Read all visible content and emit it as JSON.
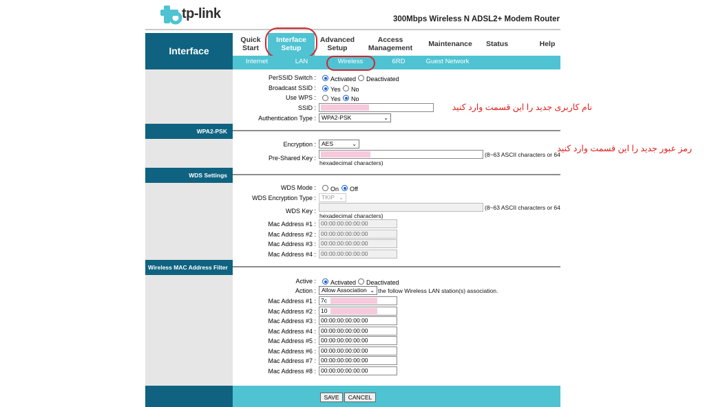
{
  "header": {
    "logo_text": "tp-link",
    "product_title": "300Mbps Wireless N ADSL2+ Modem Router"
  },
  "nav": {
    "section_label": "Interface",
    "items": [
      {
        "label": "Quick\nStart"
      },
      {
        "label": "Interface\nSetup"
      },
      {
        "label": "Advanced\nSetup"
      },
      {
        "label": "Access\nManagement"
      },
      {
        "label": "Maintenance"
      },
      {
        "label": "Status"
      },
      {
        "label": "Help"
      }
    ],
    "subitems": [
      "Internet",
      "LAN",
      "Wireless",
      "6RD",
      "Guest Network"
    ]
  },
  "ssid_section": {
    "perssid_label": "PerSSID Switch :",
    "perssid_on": "Activated",
    "perssid_off": "Deactivated",
    "broadcast_label": "Broadcast SSID :",
    "broadcast_yes": "Yes",
    "broadcast_no": "No",
    "wps_label": "Use WPS :",
    "wps_yes": "Yes",
    "wps_no": "No",
    "ssid_label": "SSID :",
    "auth_label": "Authentication Type :",
    "auth_value": "WPA2-PSK",
    "annotation": "نام کاربری جدید را این قسمت وارد کنید"
  },
  "wpa_section": {
    "title": "WPA2-PSK",
    "encryption_label": "Encryption :",
    "encryption_value": "AES",
    "psk_label": "Pre-Shared Key :",
    "psk_note": "(8~63 ASCII characters or 64",
    "psk_note2": "hexadecimal characters)",
    "annotation": "رمز عبور جدید را این قسمت وارد کنید"
  },
  "wds_section": {
    "title": "WDS Settings",
    "mode_label": "WDS Mode :",
    "mode_on": "On",
    "mode_off": "Off",
    "enc_label": "WDS Encryption Type :",
    "enc_value": "TKIP",
    "key_label": "WDS Key :",
    "key_note": "(8~63 ASCII characters or 64",
    "key_note2": "hexadecimal characters)",
    "macs": [
      {
        "label": "Mac Address #1 :",
        "value": "00:00:00:00:00:00"
      },
      {
        "label": "Mac Address #2 :",
        "value": "00:00:00:00:00:00"
      },
      {
        "label": "Mac Address #3 :",
        "value": "00:00:00:00:00:00"
      },
      {
        "label": "Mac Address #4 :",
        "value": "00:00:00:00:00:00"
      }
    ]
  },
  "mac_filter": {
    "title": "Wireless MAC Address Filter",
    "active_label": "Active :",
    "active_on": "Activated",
    "active_off": "Deactivated",
    "action_label": "Action :",
    "action_value": "Allow Association",
    "action_note": "the follow Wireless LAN station(s) association.",
    "macs": [
      {
        "label": "Mac Address #1 :",
        "value": "7c"
      },
      {
        "label": "Mac Address #2 :",
        "value": "10"
      },
      {
        "label": "Mac Address #3 :",
        "value": "00:00:00:00:00:00"
      },
      {
        "label": "Mac Address #4 :",
        "value": "00:00:00:00:00:00"
      },
      {
        "label": "Mac Address #5 :",
        "value": "00:00:00:00:00:00"
      },
      {
        "label": "Mac Address #6 :",
        "value": "00:00:00:00:00:00"
      },
      {
        "label": "Mac Address #7 :",
        "value": "00:00:00:00:00:00"
      },
      {
        "label": "Mac Address #8 :",
        "value": "00:00:00:00:00:00"
      }
    ]
  },
  "buttons": {
    "save": "SAVE",
    "cancel": "CANCEL"
  },
  "colors": {
    "nav_dark": "#0f6380",
    "nav_light": "#4fc3d2",
    "highlight_circle": "#d6242c",
    "annotation_text": "#e0201c"
  }
}
